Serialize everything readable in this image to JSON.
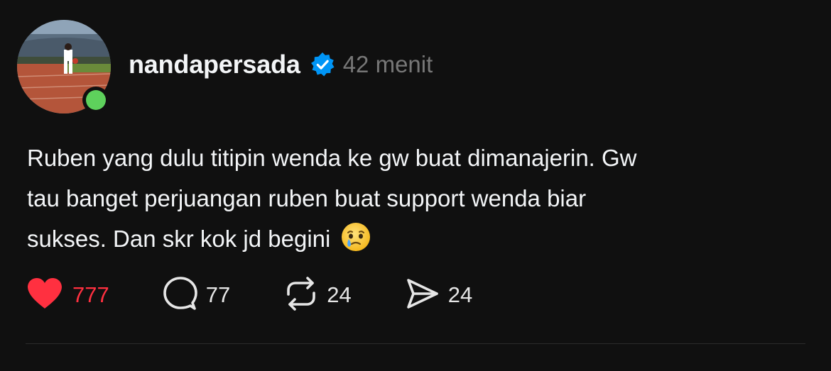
{
  "post": {
    "username": "nandapersada",
    "timestamp": "42 menit",
    "text_lines": [
      "Ruben yang dulu titipin wenda ke gw buat dimanajerin. Gw",
      "tau banget perjuangan ruben buat support wenda biar",
      "sukses. Dan skr kok jd begini"
    ],
    "emoji_icon": "face-holding-back-tears-icon",
    "actions": {
      "likes": "777",
      "replies": "77",
      "reposts": "24",
      "shares": "24"
    }
  },
  "icons": {
    "verified": "verified-badge-icon",
    "like": "heart-icon",
    "reply": "comment-bubble-icon",
    "repost": "repost-icon",
    "share": "send-icon"
  },
  "colors": {
    "background": "#101010",
    "like_active": "#ff3040",
    "verified": "#0095f6",
    "online": "#5ed15c",
    "muted_text": "#777777"
  }
}
